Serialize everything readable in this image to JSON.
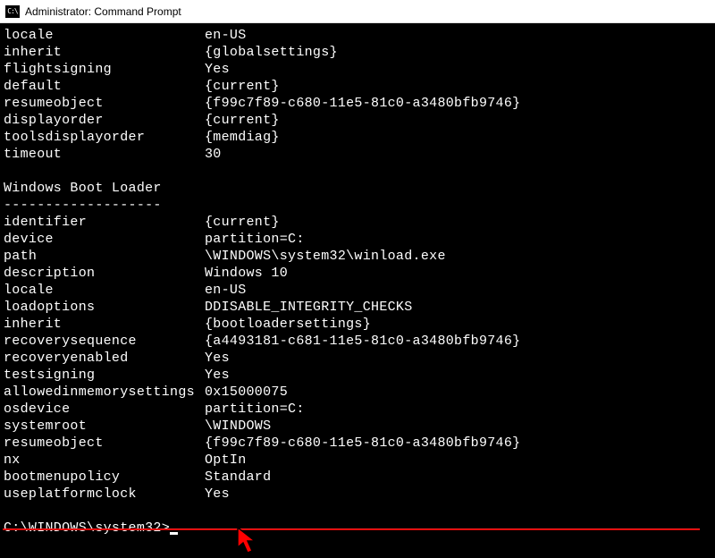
{
  "window": {
    "icon_label": "C:\\",
    "title": "Administrator: Command Prompt"
  },
  "top_rows": [
    {
      "key": "locale",
      "val": "en-US"
    },
    {
      "key": "inherit",
      "val": "{globalsettings}"
    },
    {
      "key": "flightsigning",
      "val": "Yes"
    },
    {
      "key": "default",
      "val": "{current}"
    },
    {
      "key": "resumeobject",
      "val": "{f99c7f89-c680-11e5-81c0-a3480bfb9746}"
    },
    {
      "key": "displayorder",
      "val": "{current}"
    },
    {
      "key": "toolsdisplayorder",
      "val": "{memdiag}"
    },
    {
      "key": "timeout",
      "val": "30"
    }
  ],
  "section": {
    "title": "Windows Boot Loader",
    "dashes": "-------------------"
  },
  "loader_rows": [
    {
      "key": "identifier",
      "val": "{current}"
    },
    {
      "key": "device",
      "val": "partition=C:"
    },
    {
      "key": "path",
      "val": "\\WINDOWS\\system32\\winload.exe"
    },
    {
      "key": "description",
      "val": "Windows 10"
    },
    {
      "key": "locale",
      "val": "en-US"
    },
    {
      "key": "loadoptions",
      "val": "DDISABLE_INTEGRITY_CHECKS"
    },
    {
      "key": "inherit",
      "val": "{bootloadersettings}"
    },
    {
      "key": "recoverysequence",
      "val": "{a4493181-c681-11e5-81c0-a3480bfb9746}"
    },
    {
      "key": "recoveryenabled",
      "val": "Yes"
    },
    {
      "key": "testsigning",
      "val": "Yes"
    },
    {
      "key": "allowedinmemorysettings",
      "val": "0x15000075"
    },
    {
      "key": "osdevice",
      "val": "partition=C:"
    },
    {
      "key": "systemroot",
      "val": "\\WINDOWS"
    },
    {
      "key": "resumeobject",
      "val": "{f99c7f89-c680-11e5-81c0-a3480bfb9746}"
    },
    {
      "key": "nx",
      "val": "OptIn"
    },
    {
      "key": "bootmenupolicy",
      "val": "Standard"
    },
    {
      "key": "useplatformclock",
      "val": "Yes"
    }
  ],
  "prompt": "C:\\WINDOWS\\system32>"
}
